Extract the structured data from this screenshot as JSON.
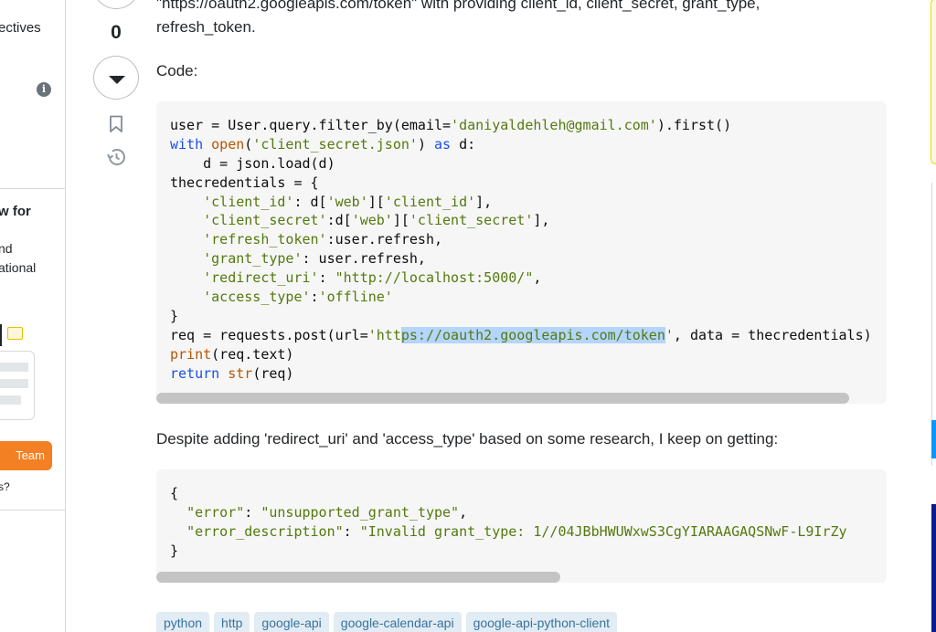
{
  "sidebar": {
    "item_top": "ectives",
    "section_title": "w for",
    "line_1": "nd",
    "line_2": "ational",
    "team_button": "Team",
    "question_fragment": "s?"
  },
  "vote": {
    "count": "0"
  },
  "post": {
    "intro_line_1": "\"https://oauth2.googleapis.com/token\" with providing client_id, client_secret, grant_type,",
    "intro_line_2": "refresh_token.",
    "code_label": "Code:",
    "middle_text": "Despite adding 'redirect_uri' and 'access_type' based on some research, I keep on getting:"
  },
  "code_block_1": [
    [
      [
        "",
        "user = User.query.filter_by(email="
      ],
      [
        "st",
        "'daniyaldehleh@gmail.com'"
      ],
      [
        "",
        ").first()"
      ]
    ],
    [
      [
        "kw",
        "with"
      ],
      [
        "",
        " "
      ],
      [
        "fn",
        "open"
      ],
      [
        "",
        "("
      ],
      [
        "st",
        "'client_secret.json'"
      ],
      [
        "",
        ") "
      ],
      [
        "kw",
        "as"
      ],
      [
        "",
        " d:"
      ]
    ],
    [
      [
        "",
        "    d = json.load(d)"
      ]
    ],
    [
      [
        "",
        "thecredentials = {"
      ]
    ],
    [
      [
        "",
        "    "
      ],
      [
        "st",
        "'client_id'"
      ],
      [
        "",
        ": d["
      ],
      [
        "st",
        "'web'"
      ],
      [
        "",
        "]["
      ],
      [
        "st",
        "'client_id'"
      ],
      [
        "",
        "],"
      ]
    ],
    [
      [
        "",
        "    "
      ],
      [
        "st",
        "'client_secret'"
      ],
      [
        "",
        ":d["
      ],
      [
        "st",
        "'web'"
      ],
      [
        "",
        "]["
      ],
      [
        "st",
        "'client_secret'"
      ],
      [
        "",
        "],"
      ]
    ],
    [
      [
        "",
        "    "
      ],
      [
        "st",
        "'refresh_token'"
      ],
      [
        "",
        ":user.refresh,"
      ]
    ],
    [
      [
        "",
        "    "
      ],
      [
        "st",
        "'grant_type'"
      ],
      [
        "",
        ": user.refresh,"
      ]
    ],
    [
      [
        "",
        "    "
      ],
      [
        "st",
        "'redirect_uri'"
      ],
      [
        "",
        ": "
      ],
      [
        "st",
        "\"http://localhost:5000/\""
      ],
      [
        "",
        ","
      ]
    ],
    [
      [
        "",
        "    "
      ],
      [
        "st",
        "'access_type'"
      ],
      [
        "",
        ":"
      ],
      [
        "st",
        "'offline'"
      ]
    ],
    [
      [
        "",
        "}"
      ]
    ],
    [
      [
        "",
        "req = requests.post(url="
      ],
      [
        "st",
        "'htt"
      ],
      [
        "st hl",
        "ps://oauth2.googleapis.com/token"
      ],
      [
        "st",
        "'"
      ],
      [
        "",
        ", data = thecredentials)"
      ]
    ],
    [
      [
        "fn",
        "print"
      ],
      [
        "",
        "(req.text)"
      ]
    ],
    [
      [
        "kw",
        "return"
      ],
      [
        "",
        " "
      ],
      [
        "fn",
        "str"
      ],
      [
        "",
        "(req)"
      ]
    ]
  ],
  "code_block_2": [
    [
      [
        "",
        "{"
      ]
    ],
    [
      [
        "",
        "  "
      ],
      [
        "st",
        "\"error\""
      ],
      [
        "",
        ": "
      ],
      [
        "st",
        "\"unsupported_grant_type\""
      ],
      [
        "",
        ","
      ]
    ],
    [
      [
        "",
        "  "
      ],
      [
        "st",
        "\"error_description\""
      ],
      [
        "",
        ": "
      ],
      [
        "st",
        "\"Invalid grant_type: 1//04JBbHWUWxwS3CgYIARAAGAQSNwF-L9IrZy"
      ]
    ],
    [
      [
        "",
        "}"
      ]
    ]
  ],
  "tags": [
    "python",
    "http",
    "google-api",
    "google-calendar-api",
    "google-api-python-client"
  ],
  "colors": {
    "keyword": "#1750eb",
    "builtin": "#b75501",
    "string": "#54790d",
    "selection": "#b4d5fe",
    "tag_bg": "#e1ecf4",
    "tag_text": "#39739d",
    "team_button": "#f48024"
  }
}
